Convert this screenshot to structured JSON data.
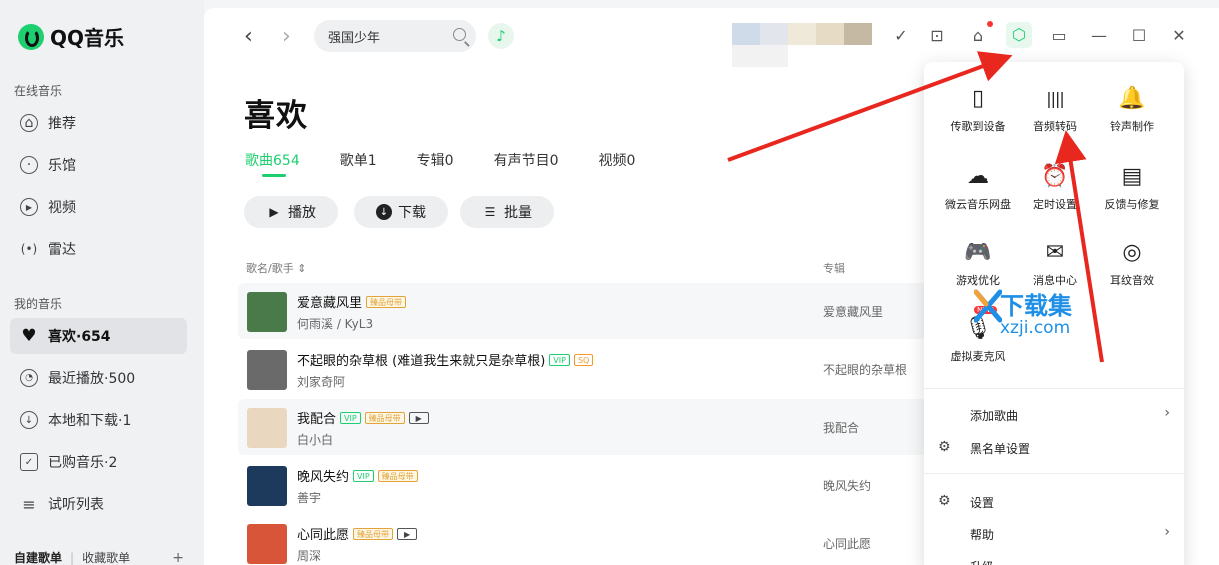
{
  "app": {
    "name": "QQ音乐"
  },
  "sidebar": {
    "online_section": "在线音乐",
    "online_items": [
      {
        "label": "推荐",
        "icon": "home-icon"
      },
      {
        "label": "乐馆",
        "icon": "disc-icon"
      },
      {
        "label": "视频",
        "icon": "play-icon"
      },
      {
        "label": "雷达",
        "icon": "radar-icon"
      }
    ],
    "my_section": "我的音乐",
    "my_items": [
      {
        "label": "喜欢·654",
        "icon": "heart-icon"
      },
      {
        "label": "最近播放·500",
        "icon": "clock-icon"
      },
      {
        "label": "本地和下载·1",
        "icon": "download-icon"
      },
      {
        "label": "已购音乐·2",
        "icon": "purchase-icon"
      },
      {
        "label": "试听列表",
        "icon": "list-icon"
      }
    ],
    "bottom_tabs": [
      "自建歌单",
      "收藏歌单"
    ],
    "add_symbol": "+"
  },
  "header": {
    "back": "‹",
    "forward": "›",
    "search_value": "强国少年",
    "music_note": "♪",
    "avatar_colors": [
      "#cfdbe8",
      "#e2e6ec",
      "#efe9da",
      "#e6dcc5",
      "#c6b9a3"
    ],
    "icons": {
      "check": "✓",
      "gamepad": "⊡",
      "shirt": "⌂",
      "settings": "⬡",
      "miniplayer": "▭",
      "minimize": "—",
      "maximize": "☐",
      "close": "✕"
    }
  },
  "page": {
    "title": "喜欢",
    "tabs": [
      "歌曲654",
      "歌单1",
      "专辑0",
      "有声节目0",
      "视频0"
    ],
    "buttons": {
      "play": "播放",
      "download": "下载",
      "batch": "批量"
    },
    "col_song": "歌名/歌手 ⇕",
    "col_album": "专辑"
  },
  "songs": [
    {
      "title": "爱意藏风里",
      "artist": "何雨溪 / KyL3",
      "album": "爱意藏风里",
      "badges": [
        "臻品母带"
      ],
      "cover": "#4a7a4a"
    },
    {
      "title": "不起眼的杂草根 (难道我生来就只是杂草根)",
      "artist": "刘家奇阿",
      "album": "不起眼的杂草根",
      "badges": [
        "VIP",
        "SQ"
      ],
      "cover": "#6a6a6a"
    },
    {
      "title": "我配合",
      "artist": "白小白",
      "album": "我配合",
      "badges": [
        "VIP",
        "臻品母带",
        "▶"
      ],
      "cover": "#e9d7c0"
    },
    {
      "title": "晚风失约",
      "artist": "善宇",
      "album": "晚风失约",
      "badges": [
        "VIP",
        "臻品母带"
      ],
      "cover": "#1d3a5c"
    },
    {
      "title": "心同此愿",
      "artist": "周深",
      "album": "心同此愿",
      "badges": [
        "臻品母带",
        "▶"
      ],
      "cover": "#d9553a"
    }
  ],
  "menu": {
    "grid": [
      {
        "label": "传歌到设备",
        "icon": "phone-icon",
        "glyph": "▯"
      },
      {
        "label": "音频转码",
        "icon": "waveform-icon",
        "glyph": "||||"
      },
      {
        "label": "铃声制作",
        "icon": "bell-icon",
        "glyph": "🔔"
      },
      {
        "label": "微云音乐网盘",
        "icon": "cloud-icon",
        "glyph": "☁"
      },
      {
        "label": "定时设置",
        "icon": "alarm-icon",
        "glyph": "⏰"
      },
      {
        "label": "反馈与修复",
        "icon": "feedback-icon",
        "glyph": "▤"
      },
      {
        "label": "游戏优化",
        "icon": "gamepad-icon",
        "glyph": "🎮"
      },
      {
        "label": "消息中心",
        "icon": "mail-icon",
        "glyph": "✉"
      },
      {
        "label": "耳纹音效",
        "icon": "ear-icon",
        "glyph": "◎"
      },
      {
        "label": "虚拟麦克风",
        "icon": "microphone-icon",
        "glyph": "🎙"
      }
    ],
    "new_badge": "NEW",
    "rows": [
      {
        "label": "添加歌曲",
        "icon": "",
        "chevron": "›"
      },
      {
        "label": "黑名单设置",
        "icon": "⚙",
        "chevron": ""
      },
      {
        "label": "设置",
        "icon": "⚙",
        "chevron": ""
      },
      {
        "label": "帮助",
        "icon": "",
        "chevron": "›"
      },
      {
        "label": "升级",
        "icon": "",
        "chevron": ""
      }
    ]
  },
  "watermark": {
    "main": "下载集",
    "sub": "xzji.com"
  },
  "colors": {
    "accent": "#1ecf70",
    "arrow": "#e8271f",
    "watermark": "#1e8fe6"
  }
}
